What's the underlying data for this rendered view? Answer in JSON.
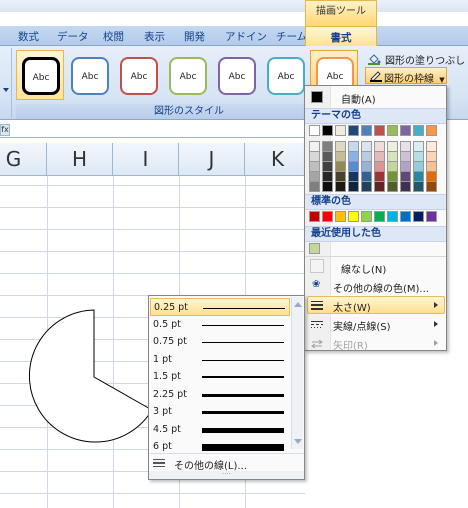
{
  "ribbon": {
    "context_tab": "描画ツール",
    "tabs": [
      "数式",
      "データ",
      "校閲",
      "表示",
      "開発",
      "アドイン",
      "チーム"
    ],
    "active_tab": "書式",
    "gallery": {
      "item_label": "Abc",
      "group_label": "図形のスタイル",
      "styles": [
        {
          "border": "#000000",
          "state": "selected"
        },
        {
          "border": "#4f81bd",
          "state": "normal"
        },
        {
          "border": "#c0504d",
          "state": "normal"
        },
        {
          "border": "#9bbb59",
          "state": "normal"
        },
        {
          "border": "#8064a2",
          "state": "normal"
        },
        {
          "border": "#4bacc6",
          "state": "normal"
        },
        {
          "border": "#f79646",
          "state": "hover"
        }
      ]
    },
    "fill_command": "図形の塗りつぶし",
    "outline_command": "図形の枠線"
  },
  "sheet": {
    "name_box_stub": "fx",
    "columns": [
      "G",
      "H",
      "I",
      "J",
      "K"
    ]
  },
  "color_menu": {
    "automatic": "自動(A)",
    "theme_colors_header": "テーマの色",
    "theme_top_row": [
      "#ffffff",
      "#000000",
      "#eeece1",
      "#1f497d",
      "#4f81bd",
      "#c0504d",
      "#9bbb59",
      "#8064a2",
      "#4bacc6",
      "#f79646"
    ],
    "theme_shades": [
      [
        "#f2f2f2",
        "#7f7f7f",
        "#ddd9c3",
        "#c6d9f0",
        "#dbe5f1",
        "#f2dcdb",
        "#ebf1dd",
        "#e5e0ec",
        "#dbeef3",
        "#fdeada"
      ],
      [
        "#d8d8d8",
        "#595959",
        "#c4bd97",
        "#8db3e2",
        "#b8cce4",
        "#e5b9b7",
        "#d7e3bc",
        "#ccc1d9",
        "#b7dde8",
        "#fbd5b5"
      ],
      [
        "#bfbfbf",
        "#3f3f3f",
        "#938953",
        "#548dd4",
        "#95b3d7",
        "#d99694",
        "#c3d69b",
        "#b2a2c7",
        "#92cddc",
        "#fac08f"
      ],
      [
        "#a5a5a5",
        "#262626",
        "#494429",
        "#17365d",
        "#366092",
        "#953734",
        "#76923c",
        "#5f497a",
        "#31859b",
        "#e36c09"
      ],
      [
        "#7f7f7f",
        "#0c0c0c",
        "#1d1b10",
        "#0f243e",
        "#244061",
        "#632423",
        "#4f6128",
        "#3f3151",
        "#205867",
        "#974806"
      ]
    ],
    "standard_colors_header": "標準の色",
    "standard_colors": [
      "#c00000",
      "#ff0000",
      "#ffc000",
      "#ffff00",
      "#92d050",
      "#00b050",
      "#00b0f0",
      "#0070c0",
      "#002060",
      "#7030a0"
    ],
    "recent_colors_header": "最近使用した色",
    "recent_colors": [
      "#c3d69b"
    ],
    "no_line": "線なし(N)",
    "more_colors": "その他の線の色(M)...",
    "weight": "太さ(W)",
    "dashes": "実線/点線(S)",
    "arrows": "矢印(R)"
  },
  "weight_menu": {
    "options": [
      {
        "label": "0.25  pt",
        "weight": 0.25
      },
      {
        "label": "0.5  pt",
        "weight": 0.5
      },
      {
        "label": "0.75  pt",
        "weight": 0.75
      },
      {
        "label": "1  pt",
        "weight": 1
      },
      {
        "label": "1.5  pt",
        "weight": 1.5
      },
      {
        "label": "2.25  pt",
        "weight": 2.25
      },
      {
        "label": "3  pt",
        "weight": 3
      },
      {
        "label": "4.5  pt",
        "weight": 4.5
      },
      {
        "label": "6  pt",
        "weight": 6
      }
    ],
    "selected_index": 0,
    "more_lines": "その他の線(L)..."
  }
}
